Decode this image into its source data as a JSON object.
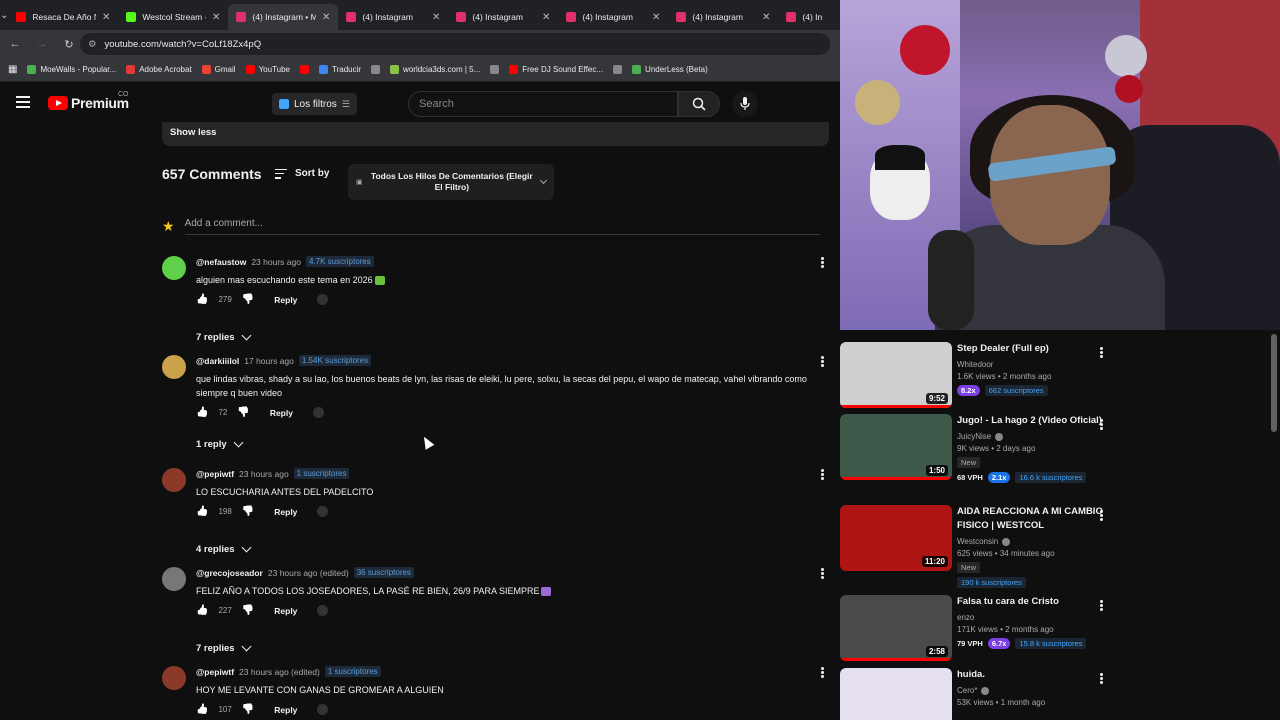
{
  "browser": {
    "tabs": [
      {
        "title": "Resaca De Año N",
        "color": "#ff0000",
        "active": false
      },
      {
        "title": "Westcol Stream -",
        "color": "#53fc18",
        "active": false
      },
      {
        "title": "(4) Instagram • M",
        "color": "#e1306c",
        "active": true
      },
      {
        "title": "(4) Instagram",
        "color": "#e1306c",
        "active": false
      },
      {
        "title": "(4) Instagram",
        "color": "#e1306c",
        "active": false
      },
      {
        "title": "(4) Instagram",
        "color": "#e1306c",
        "active": false
      },
      {
        "title": "(4) Instagram",
        "color": "#e1306c",
        "active": false
      },
      {
        "title": "(4) In",
        "color": "#e1306c",
        "active": false
      }
    ],
    "url": "youtube.com/watch?v=CoLf18Zx4pQ",
    "bookmarks": [
      {
        "label": "MoeWalls - Popular...",
        "color": "#4caf50"
      },
      {
        "label": "Adobe Acrobat",
        "color": "#e53935"
      },
      {
        "label": "Gmail",
        "color": "#ea4335"
      },
      {
        "label": "YouTube",
        "color": "#ff0000"
      },
      {
        "label": "",
        "color": "#ff0000"
      },
      {
        "label": "Traducir",
        "color": "#4285f4"
      },
      {
        "label": "",
        "color": "#888888"
      },
      {
        "label": "worldcia3ds.com | 5...",
        "color": "#8bc34a"
      },
      {
        "label": "",
        "color": "#888888"
      },
      {
        "label": "Free DJ Sound Effec...",
        "color": "#ff0000"
      },
      {
        "label": "",
        "color": "#888888"
      },
      {
        "label": "UnderLess (Beta)",
        "color": "#4caf50"
      }
    ]
  },
  "youtube": {
    "logo_text": "Premium",
    "country_code": "CO",
    "filter_chip": "Los filtros",
    "search_placeholder": "Search",
    "show_less": "Show less",
    "comments_count": "657 Comments",
    "sort_by": "Sort by",
    "thread_selector": "Todos Los Hilos De Comentarios (Elegir El Filtro)",
    "add_comment_placeholder": "Add a comment...",
    "comments": [
      {
        "user": "@nefaustow",
        "time": "23 hours ago",
        "subs": "4.7K suscriptores",
        "text": "alguien mas escuchando este tema en 2026",
        "likes": "279",
        "reply": "Reply",
        "replies": "7 replies",
        "avatar_color": "#5fd04a"
      },
      {
        "user": "@darkiiilol",
        "time": "17 hours ago",
        "subs": "1.54K suscriptores",
        "text": "que lindas vibras, shady a su lao, los buenos beats de lyn, las risas de eleiki, lu pere, solxu, la secas del pepu, el wapo de matecap, vahel vibrando como siempre q buen video",
        "likes": "72",
        "reply": "Reply",
        "replies": "1 reply",
        "avatar_color": "#c9a24a"
      },
      {
        "user": "@pepiwtf",
        "time": "23 hours ago",
        "subs": "1 suscriptores",
        "text": "LO ESCUCHARIA ANTES DEL PADELCITO",
        "likes": "198",
        "reply": "Reply",
        "replies": "4 replies",
        "avatar_color": "#8b3a2a"
      },
      {
        "user": "@grecojoseador",
        "time": "23 hours ago (edited)",
        "subs": "36 suscriptores",
        "text": "FELIZ AÑO A TODOS LOS JOSEADORES, LA PASÉ RE BIEN, 26/9 PARA SIEMPRE",
        "likes": "227",
        "reply": "Reply",
        "replies": "7 replies",
        "avatar_color": "#777777"
      },
      {
        "user": "@pepiwtf",
        "time": "23 hours ago (edited)",
        "subs": "1 suscriptores",
        "text": "HOY ME LEVANTE CON GANAS DE GROMEAR A ALGUIEN",
        "likes": "107",
        "reply": "Reply",
        "replies": "",
        "avatar_color": "#8b3a2a"
      }
    ]
  },
  "recommendations": [
    {
      "title": "Step Dealer (Full ep)",
      "channel": "Whitedoor",
      "verified": false,
      "meta": "1.6K views • 2 months ago",
      "duration": "9:52",
      "new": false,
      "vph": "",
      "pill": "8.2x",
      "pill_color": "#7b3fe4",
      "subs": "662 suscriptores",
      "thumb_color": "#cfcfcf",
      "progress": 1.0
    },
    {
      "title": "Jugo! - La hago 2 (Video Oficial)",
      "channel": "JuicyNise",
      "verified": true,
      "meta": "9K views • 2 days ago",
      "duration": "1:50",
      "new": true,
      "vph": "68 VPH",
      "pill": "2.1x",
      "pill_color": "#1a73e8",
      "subs": "16.6 k suscriptores",
      "thumb_color": "#3d5a4a",
      "progress": 1.0
    },
    {
      "title": "AIDA REACCIONA A MI CAMBIO FISICO | WESTCOL",
      "channel": "Westconsin",
      "verified": true,
      "meta": "625 views • 34 minutes ago",
      "duration": "11:20",
      "new": true,
      "vph": "",
      "pill": "",
      "pill_color": "",
      "subs": "190 k suscriptores",
      "thumb_color": "#b01515",
      "progress": 0
    },
    {
      "title": "Falsa tu cara de Cristo",
      "channel": "enzo",
      "verified": false,
      "meta": "171K views • 2 months ago",
      "duration": "2:58",
      "new": false,
      "vph": "79 VPH",
      "pill": "6.7x",
      "pill_color": "#7b3fe4",
      "subs": "15.8 k suscriptores",
      "thumb_color": "#4a4a4a",
      "progress": 1.0
    },
    {
      "title": "huida.",
      "channel": "Cero*",
      "verified": true,
      "meta": "53K views • 1 month ago",
      "duration": "",
      "new": false,
      "vph": "",
      "pill": "",
      "pill_color": "",
      "subs": "",
      "thumb_color": "#e6dff0",
      "progress": 0
    }
  ]
}
